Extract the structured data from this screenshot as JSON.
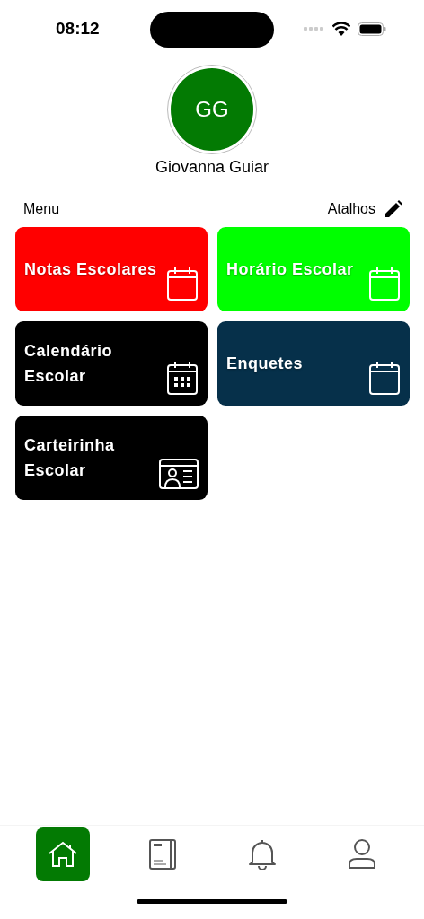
{
  "status_bar": {
    "time": "08:12"
  },
  "profile": {
    "initials": "GG",
    "name": "Giovanna Guiar",
    "color": "#037a03"
  },
  "section": {
    "title": "Menu",
    "shortcuts_label": "Atalhos"
  },
  "tiles": [
    {
      "title": "Notas Escolares",
      "color": "#ff0000",
      "kind": "calendar"
    },
    {
      "title": "Horário Escolar",
      "color": "#00ff00",
      "kind": "calendar"
    },
    {
      "title": "Calendário Escolar",
      "color": "#000000",
      "kind": "calendar-grid"
    },
    {
      "title": "Enquetes",
      "color": "#06304a",
      "kind": "calendar"
    },
    {
      "title": "Carteirinha Escolar",
      "color": "#000000",
      "kind": "id-card"
    }
  ],
  "tab_bar": [
    {
      "kind": "home",
      "selected": true
    },
    {
      "kind": "book",
      "selected": false
    },
    {
      "kind": "bell",
      "selected": false
    },
    {
      "kind": "profile",
      "selected": false
    }
  ]
}
